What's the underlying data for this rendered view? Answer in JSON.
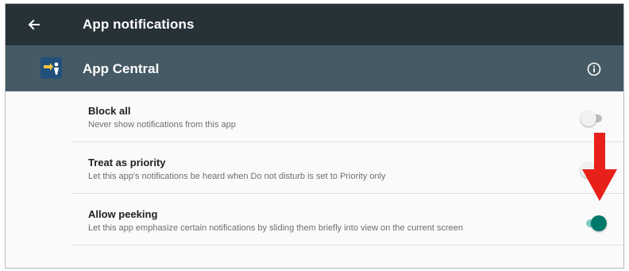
{
  "header": {
    "back_icon": "arrow-left-icon",
    "title": "App notifications"
  },
  "app": {
    "icon": "app-central-logo-icon",
    "name": "App Central",
    "info_icon": "info-circle-icon"
  },
  "settings": [
    {
      "title": "Block all",
      "description": "Never show notifications from this app",
      "enabled": false
    },
    {
      "title": "Treat as priority",
      "description": "Let this app's notifications be heard when Do not disturb is set to Priority only",
      "enabled": false
    },
    {
      "title": "Allow peeking",
      "description": "Let this app emphasize certain notifications by sliding them briefly into view on the current screen",
      "enabled": true
    }
  ],
  "annotation": {
    "icon": "red-down-arrow-icon",
    "color": "#e8201a"
  },
  "colors": {
    "topbar": "#263238",
    "appbar": "#455a64",
    "toggle_on": "#00796b",
    "toggle_off": "#bdbdbd"
  }
}
